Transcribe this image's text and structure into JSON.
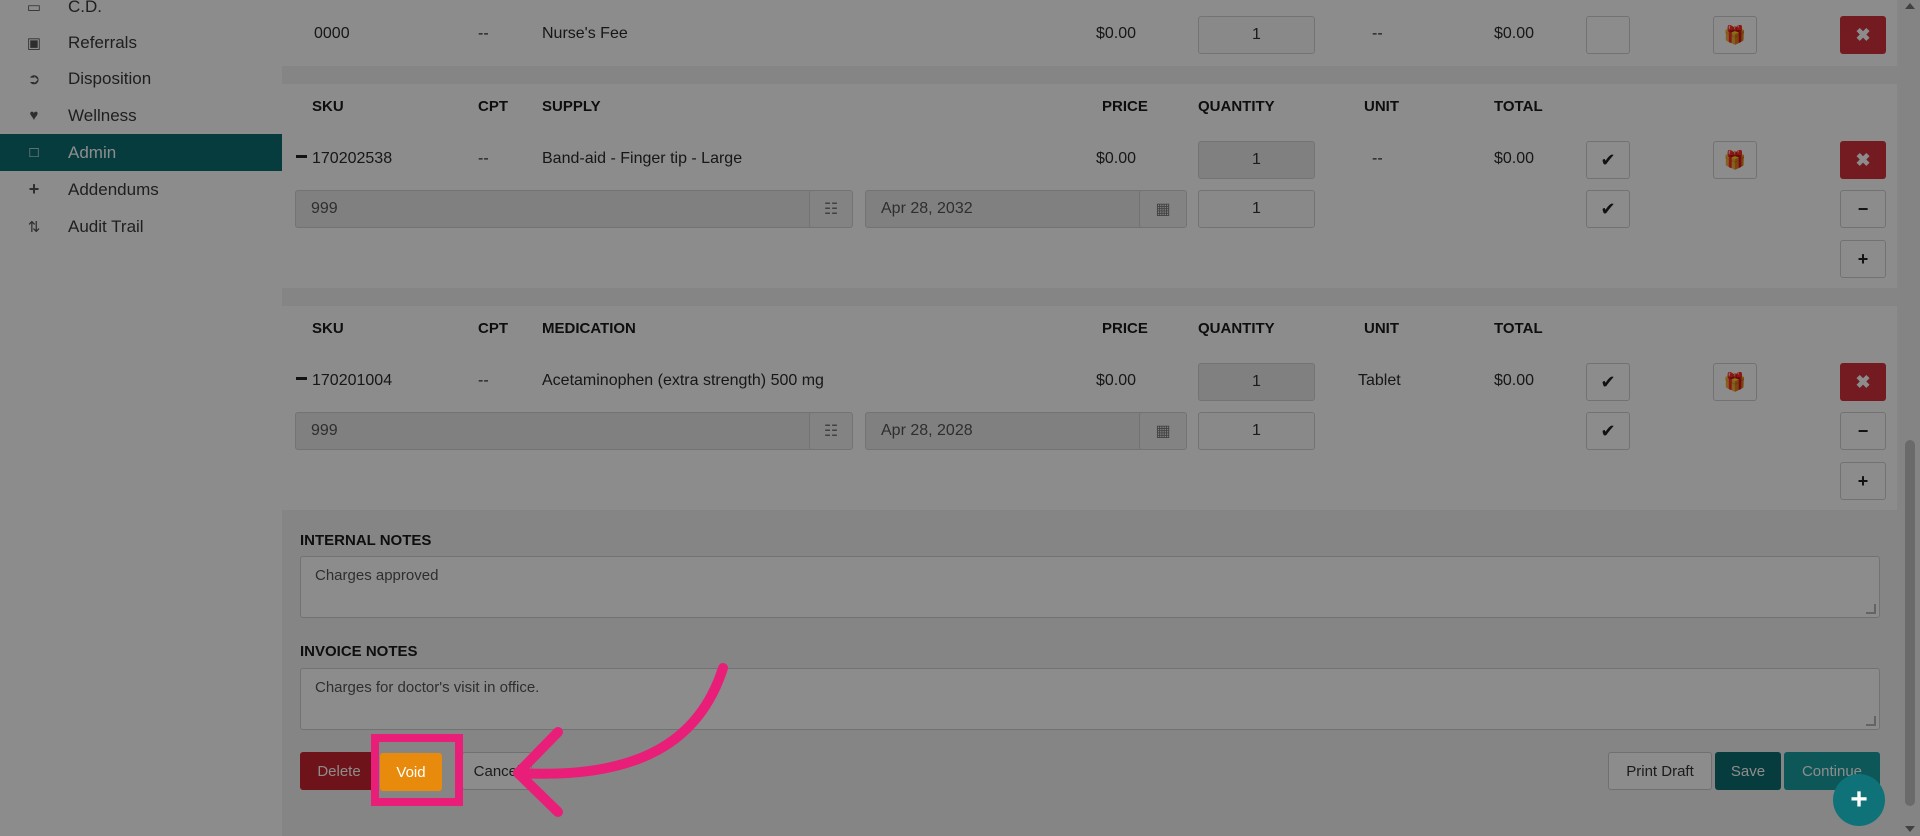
{
  "sidebar": {
    "items": [
      {
        "label": "C.D.",
        "icon": "ambulance-icon"
      },
      {
        "label": "Referrals",
        "icon": "referral-icon"
      },
      {
        "label": "Disposition",
        "icon": "sign-out-icon"
      },
      {
        "label": "Wellness",
        "icon": "heartbeat-icon"
      },
      {
        "label": "Admin",
        "icon": "document-icon",
        "active": true
      },
      {
        "label": "Addendums",
        "icon": "plus-icon"
      },
      {
        "label": "Audit Trail",
        "icon": "sort-icon"
      }
    ]
  },
  "nurse_row": {
    "sku": "0000",
    "cpt": "--",
    "name": "Nurse's Fee",
    "price": "$0.00",
    "quantity": "1",
    "unit": "--",
    "total": "$0.00"
  },
  "supply": {
    "headers": {
      "sku": "SKU",
      "cpt": "CPT",
      "name": "SUPPLY",
      "price": "PRICE",
      "quantity": "QUANTITY",
      "unit": "UNIT",
      "total": "TOTAL"
    },
    "row": {
      "sku": "170202538",
      "cpt": "--",
      "name": "Band-aid - Finger tip - Large",
      "price": "$0.00",
      "quantity": "1",
      "unit": "--",
      "total": "$0.00"
    },
    "lot": {
      "lot_number": "999",
      "expiry": "Apr 28, 2032",
      "quantity": "1"
    }
  },
  "medication": {
    "headers": {
      "sku": "SKU",
      "cpt": "CPT",
      "name": "MEDICATION",
      "price": "PRICE",
      "quantity": "QUANTITY",
      "unit": "UNIT",
      "total": "TOTAL"
    },
    "row": {
      "sku": "170201004",
      "cpt": "--",
      "name": "Acetaminophen (extra strength) 500 mg",
      "price": "$0.00",
      "quantity": "1",
      "unit": "Tablet",
      "total": "$0.00"
    },
    "lot": {
      "lot_number": "999",
      "expiry": "Apr 28, 2028",
      "quantity": "1"
    }
  },
  "notes": {
    "internal_label": "INTERNAL NOTES",
    "internal_value": "Charges approved",
    "invoice_label": "INVOICE NOTES",
    "invoice_value": "Charges for doctor's visit in office."
  },
  "actions": {
    "delete": "Delete",
    "void": "Void",
    "cancel": "Cancel",
    "print_draft": "Print Draft",
    "save": "Save",
    "continue": "Continue"
  },
  "colors": {
    "accent": "#0e6d72",
    "danger": "#d4323e",
    "void": "#e88a0c",
    "highlight": "#e91e78"
  }
}
